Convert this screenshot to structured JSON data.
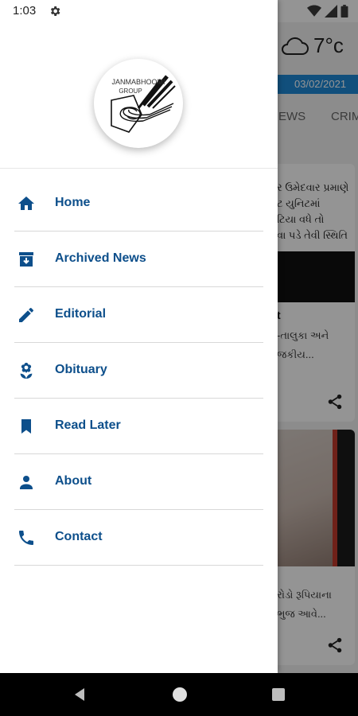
{
  "status_bar": {
    "time": "1:03"
  },
  "drawer": {
    "logo": {
      "line1": "JANMABHOOMI",
      "line2": "GROUP"
    },
    "menu": [
      {
        "label": "Home",
        "icon": "home-icon"
      },
      {
        "label": "Archived News",
        "icon": "archive-icon"
      },
      {
        "label": "Editorial",
        "icon": "pencil-icon"
      },
      {
        "label": "Obituary",
        "icon": "flower-icon"
      },
      {
        "label": "Read Later",
        "icon": "bookmark-icon"
      },
      {
        "label": "About",
        "icon": "person-icon"
      },
      {
        "label": "Contact",
        "icon": "phone-icon"
      }
    ]
  },
  "background_app": {
    "temperature": "7°c",
    "date": "03/02/2021",
    "tabs": [
      "EWS",
      "CRIM"
    ],
    "card1": {
      "headline_lines": [
        "ર ઉમેદવાર પ્રમાણે",
        "ટ યુનિટમાં",
        "ટિયા વધે તો",
        "વા પડે તેવી સ્થિતિ"
      ],
      "title": "t",
      "body_lines": [
        "-તાલુકા અને",
        "જકીય..."
      ]
    },
    "card2": {
      "body_lines": [
        "રોડો રૂપિયાના",
        "ભુજ આવે..."
      ]
    }
  },
  "colors": {
    "accent": "#0d4f8b",
    "date_bar": "#1e88d6"
  }
}
